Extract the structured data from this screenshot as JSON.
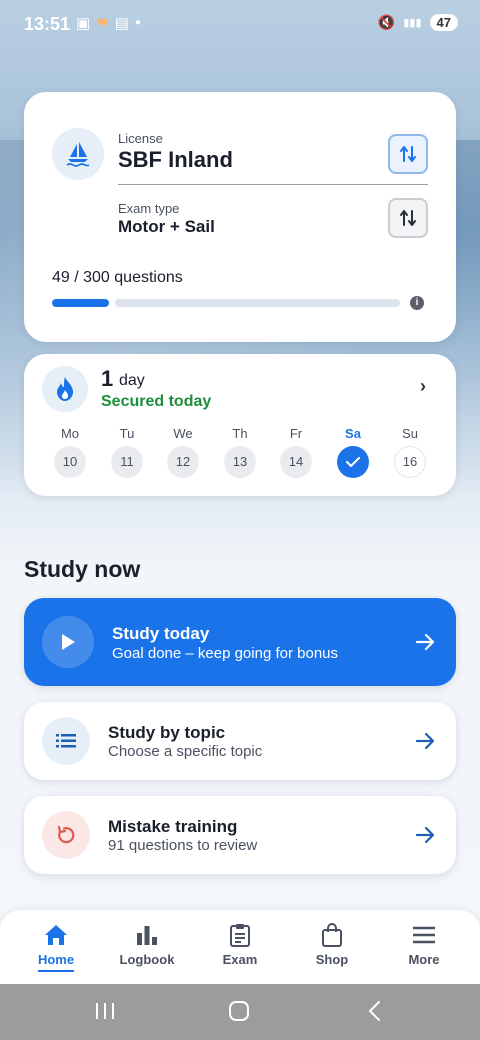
{
  "status_bar": {
    "time": "13:51",
    "battery": "47",
    "icons_left": [
      "screenshot-icon",
      "heart-icon",
      "app-icon",
      "dot-icon"
    ],
    "icons_right": [
      "mute-icon",
      "signal-icon",
      "battery-icon"
    ]
  },
  "license_card": {
    "license_label": "License",
    "license_value": "SBF Inland",
    "exam_type_label": "Exam type",
    "exam_type_value": "Motor + Sail",
    "progress_text": "49 / 300 questions",
    "progress_fraction": 0.163,
    "info_symbol": "i"
  },
  "streak": {
    "count": "1",
    "unit": "day",
    "status": "Secured today",
    "days": [
      {
        "label": "Mo",
        "date": "10",
        "state": "past"
      },
      {
        "label": "Tu",
        "date": "11",
        "state": "past"
      },
      {
        "label": "We",
        "date": "12",
        "state": "past"
      },
      {
        "label": "Th",
        "date": "13",
        "state": "past"
      },
      {
        "label": "Fr",
        "date": "14",
        "state": "past"
      },
      {
        "label": "Sa",
        "date": "",
        "state": "done"
      },
      {
        "label": "Su",
        "date": "16",
        "state": "future"
      }
    ]
  },
  "study_now": {
    "title": "Study now",
    "actions": [
      {
        "title": "Study today",
        "subtitle": "Goal done – keep going for bonus",
        "icon": "play-icon"
      },
      {
        "title": "Study by topic",
        "subtitle": "Choose a specific topic",
        "icon": "list-icon"
      },
      {
        "title": "Mistake training",
        "subtitle": "91 questions to review",
        "icon": "retry-icon"
      }
    ]
  },
  "nav": {
    "items": [
      {
        "label": "Home",
        "icon": "home-icon",
        "active": true
      },
      {
        "label": "Logbook",
        "icon": "bar-chart-icon",
        "active": false
      },
      {
        "label": "Exam",
        "icon": "clipboard-icon",
        "active": false
      },
      {
        "label": "Shop",
        "icon": "shopping-bag-icon",
        "active": false
      },
      {
        "label": "More",
        "icon": "menu-icon",
        "active": false
      }
    ]
  },
  "colors": {
    "accent": "#1a73e8",
    "success": "#1e8e3e",
    "mistake": "#e05a4f"
  }
}
